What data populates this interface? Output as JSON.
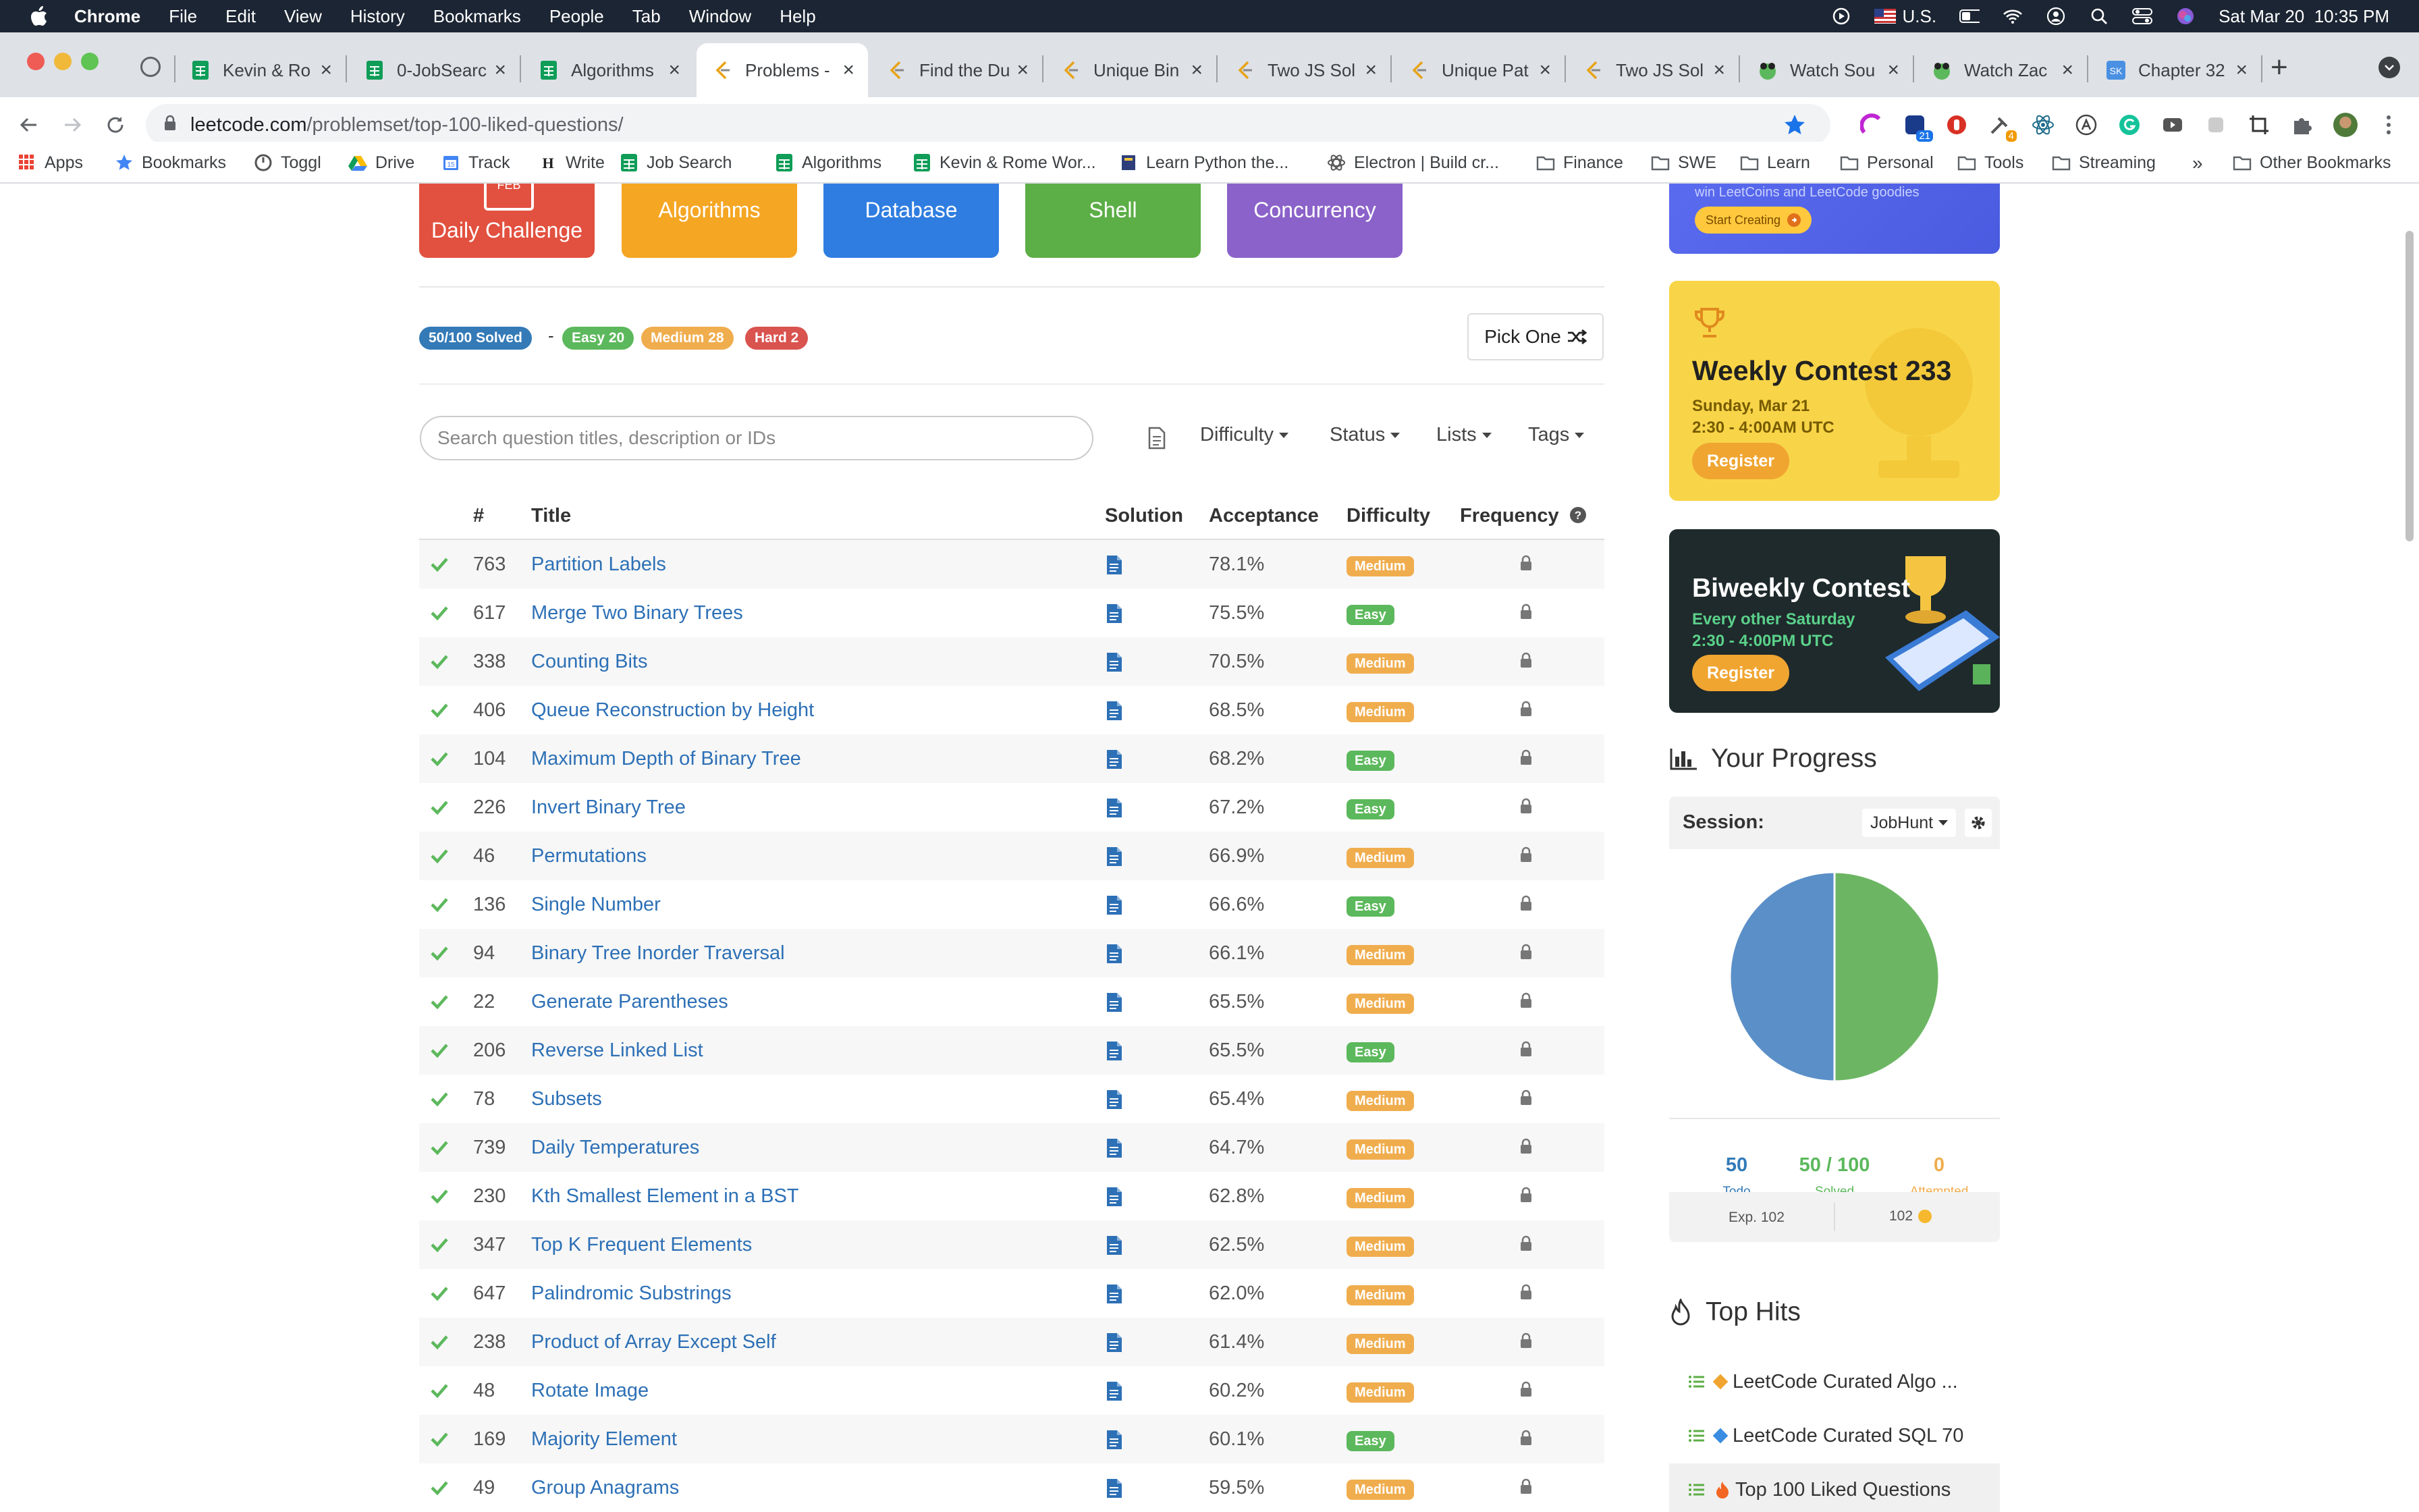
{
  "menubar": {
    "app": "Chrome",
    "items": [
      "File",
      "Edit",
      "View",
      "History",
      "Bookmarks",
      "People",
      "Tab",
      "Window",
      "Help"
    ],
    "input_source": "U.S.",
    "clock": "Sat Mar 20  10:35 PM"
  },
  "tabs": [
    {
      "title": "Kevin & Ro",
      "icon": "sheets-icon"
    },
    {
      "title": "0-JobSearc",
      "icon": "sheets-icon"
    },
    {
      "title": "Algorithms",
      "icon": "sheets-icon"
    },
    {
      "title": "Problems -",
      "icon": "leetcode-icon",
      "active": true
    },
    {
      "title": "Find the Du",
      "icon": "leetcode-icon"
    },
    {
      "title": "Unique Bin",
      "icon": "leetcode-icon"
    },
    {
      "title": "Two JS Sol",
      "icon": "leetcode-icon"
    },
    {
      "title": "Unique Pat",
      "icon": "leetcode-icon"
    },
    {
      "title": "Two JS Sol",
      "icon": "leetcode-icon"
    },
    {
      "title": "Watch Sou",
      "icon": "frog-icon"
    },
    {
      "title": "Watch Zac",
      "icon": "frog-icon"
    },
    {
      "title": "Chapter 32",
      "icon": "blue-app-icon"
    }
  ],
  "omnibox": {
    "host": "leetcode.com",
    "path": "/problemset/top-100-liked-questions/"
  },
  "extension_badges": {
    "ext1": "21",
    "ext2": "4"
  },
  "bookmarks": [
    {
      "label": "Apps",
      "icon": "apps-grid-icon"
    },
    {
      "label": "Bookmarks",
      "icon": "star-icon"
    },
    {
      "label": "Toggl",
      "icon": "toggl-icon"
    },
    {
      "label": "Drive",
      "icon": "drive-icon"
    },
    {
      "label": "Track",
      "icon": "calendar-icon"
    },
    {
      "label": "Write",
      "icon": "hashnode-icon"
    },
    {
      "label": "Job Search",
      "icon": "sheets-icon"
    },
    {
      "label": "Algorithms",
      "icon": "sheets-icon"
    },
    {
      "label": "Kevin & Rome Wor...",
      "icon": "sheets-icon"
    },
    {
      "label": "Learn Python the...",
      "icon": "book-icon"
    },
    {
      "label": "Electron | Build cr...",
      "icon": "electron-icon"
    },
    {
      "label": "Finance",
      "icon": "folder-icon"
    },
    {
      "label": "SWE",
      "icon": "folder-icon"
    },
    {
      "label": "Learn",
      "icon": "folder-icon"
    },
    {
      "label": "Personal",
      "icon": "folder-icon"
    },
    {
      "label": "Tools",
      "icon": "folder-icon"
    },
    {
      "label": "Streaming",
      "icon": "folder-icon"
    }
  ],
  "overflow_label": "»",
  "other_bookmarks": "Other Bookmarks",
  "categories": [
    {
      "label": "Daily Challenge",
      "badge": "FEB"
    },
    {
      "label": "Algorithms"
    },
    {
      "label": "Database"
    },
    {
      "label": "Shell"
    },
    {
      "label": "Concurrency"
    }
  ],
  "summary": {
    "solved": "50/100 Solved",
    "dash": "-",
    "easy": "Easy 20",
    "medium": "Medium 28",
    "hard": "Hard 2"
  },
  "pick_one": "Pick One",
  "search_placeholder": "Search question titles, description or IDs",
  "filters": {
    "difficulty": "Difficulty",
    "status": "Status",
    "lists": "Lists",
    "tags": "Tags"
  },
  "table": {
    "headers": {
      "num": "#",
      "title": "Title",
      "solution": "Solution",
      "acceptance": "Acceptance",
      "difficulty": "Difficulty",
      "frequency": "Frequency"
    },
    "rows": [
      {
        "id": "763",
        "title": "Partition Labels",
        "acceptance": "78.1%",
        "difficulty": "Medium"
      },
      {
        "id": "617",
        "title": "Merge Two Binary Trees",
        "acceptance": "75.5%",
        "difficulty": "Easy"
      },
      {
        "id": "338",
        "title": "Counting Bits",
        "acceptance": "70.5%",
        "difficulty": "Medium"
      },
      {
        "id": "406",
        "title": "Queue Reconstruction by Height",
        "acceptance": "68.5%",
        "difficulty": "Medium"
      },
      {
        "id": "104",
        "title": "Maximum Depth of Binary Tree",
        "acceptance": "68.2%",
        "difficulty": "Easy"
      },
      {
        "id": "226",
        "title": "Invert Binary Tree",
        "acceptance": "67.2%",
        "difficulty": "Easy"
      },
      {
        "id": "46",
        "title": "Permutations",
        "acceptance": "66.9%",
        "difficulty": "Medium"
      },
      {
        "id": "136",
        "title": "Single Number",
        "acceptance": "66.6%",
        "difficulty": "Easy"
      },
      {
        "id": "94",
        "title": "Binary Tree Inorder Traversal",
        "acceptance": "66.1%",
        "difficulty": "Medium"
      },
      {
        "id": "22",
        "title": "Generate Parentheses",
        "acceptance": "65.5%",
        "difficulty": "Medium"
      },
      {
        "id": "206",
        "title": "Reverse Linked List",
        "acceptance": "65.5%",
        "difficulty": "Easy"
      },
      {
        "id": "78",
        "title": "Subsets",
        "acceptance": "65.4%",
        "difficulty": "Medium"
      },
      {
        "id": "739",
        "title": "Daily Temperatures",
        "acceptance": "64.7%",
        "difficulty": "Medium"
      },
      {
        "id": "230",
        "title": "Kth Smallest Element in a BST",
        "acceptance": "62.8%",
        "difficulty": "Medium"
      },
      {
        "id": "347",
        "title": "Top K Frequent Elements",
        "acceptance": "62.5%",
        "difficulty": "Medium"
      },
      {
        "id": "647",
        "title": "Palindromic Substrings",
        "acceptance": "62.0%",
        "difficulty": "Medium"
      },
      {
        "id": "238",
        "title": "Product of Array Except Self",
        "acceptance": "61.4%",
        "difficulty": "Medium"
      },
      {
        "id": "48",
        "title": "Rotate Image",
        "acceptance": "60.2%",
        "difficulty": "Medium"
      },
      {
        "id": "169",
        "title": "Majority Element",
        "acceptance": "60.1%",
        "difficulty": "Easy"
      },
      {
        "id": "49",
        "title": "Group Anagrams",
        "acceptance": "59.5%",
        "difficulty": "Medium"
      }
    ]
  },
  "promo": {
    "text": "win LeetCoins and LeetCode goodies",
    "button": "Start Creating"
  },
  "weekly": {
    "title": "Weekly Contest 233",
    "date": "Sunday, Mar 21",
    "time": "2:30 - 4:00AM UTC",
    "button": "Register"
  },
  "biweekly": {
    "title": "Biweekly Contest",
    "schedule": "Every other Saturday",
    "time": "2:30 - 4:00PM UTC",
    "button": "Register"
  },
  "progress": {
    "title": "Your Progress",
    "session_label": "Session:",
    "session_value": "JobHunt",
    "todo_value": "50",
    "todo_label": "Todo",
    "solved_value": "50 / 100",
    "solved_label": "Solved",
    "attempted_value": "0",
    "attempted_label": "Attempted",
    "exp": "Exp. 102",
    "coins": "102",
    "pie": {
      "todo": 50,
      "solved": 50,
      "attempted": 0
    }
  },
  "top_hits": {
    "title": "Top Hits",
    "items": [
      "LeetCode Curated Algo ...",
      "LeetCode Curated SQL 70",
      "Top 100 Liked Questions"
    ]
  },
  "colors": {
    "easy": "#5cb85c",
    "medium": "#f0ad4e",
    "hard": "#d9534f",
    "solved": "#337ab7",
    "link": "#2d70b6",
    "todo": "#5b8fc8",
    "done": "#6cb663"
  }
}
